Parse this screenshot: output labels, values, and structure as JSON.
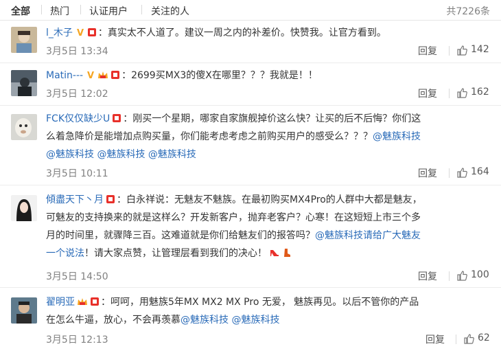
{
  "tabs": {
    "all": "全部",
    "hot": "热门",
    "verified": "认证用户",
    "following": "关注的人",
    "total": "共7226条"
  },
  "comments": [
    {
      "username": "l_木子",
      "text": "：真实太不人道了。建议一周之内的补差价。快赞我。让官方看到。",
      "time": "3月5日 13:34",
      "reply": "回复",
      "likes": "142"
    },
    {
      "username": "Matin---",
      "text": "：2699买MX3的傻X在哪里？？？我就是！！",
      "time": "3月5日 12:02",
      "reply": "回复",
      "likes": "162"
    },
    {
      "username": "FCK仅仅缺少U",
      "line1": "：刚买一个星期，哪家自家旗舰掉价这么快？让买的后不后悔？你们这",
      "line2": "么着急降价是能增加点购买量，你们能考虑考虑之前购买用户的感受么？？？",
      "mention": "@魅族科技",
      "time": "3月5日 10:11",
      "reply": "回复",
      "likes": "164"
    },
    {
      "username": "傾盡天下丶月",
      "line1": "：白永祥说：无魅友不魅族。在最初购买MX4Pro的人群中大都是魅友，",
      "line2": "可魅友的支持换来的就是这样么？开发新客户，抛弃老客户？心寒！在这短短上市三个多",
      "line3": "月的时间里，就骤降三百。这难道就是你们给魅友们的报答吗？",
      "line3_link": "@魅族科技请给广大魅友",
      "line4_link": "一个说法",
      "line4": "！请大家点赞，让管理层看到我们的决心！",
      "time": "3月5日 14:50",
      "reply": "回复",
      "likes": "100"
    },
    {
      "username": "翟明亚",
      "line1": "：呵呵，用魅族5年MX MX2 MX Pro 无爱， 魅族再见。以后不管你的产品",
      "line2": "在怎么牛逼，放心，不会再羡慕",
      "mention": "@魅族科技",
      "time": "3月5日 12:13",
      "reply": "回复",
      "likes": "62"
    }
  ],
  "colors": {
    "link": "#2a6bb8",
    "muted": "#808080",
    "vip_red": "#e8302a",
    "v_gold": "#f5a623"
  }
}
